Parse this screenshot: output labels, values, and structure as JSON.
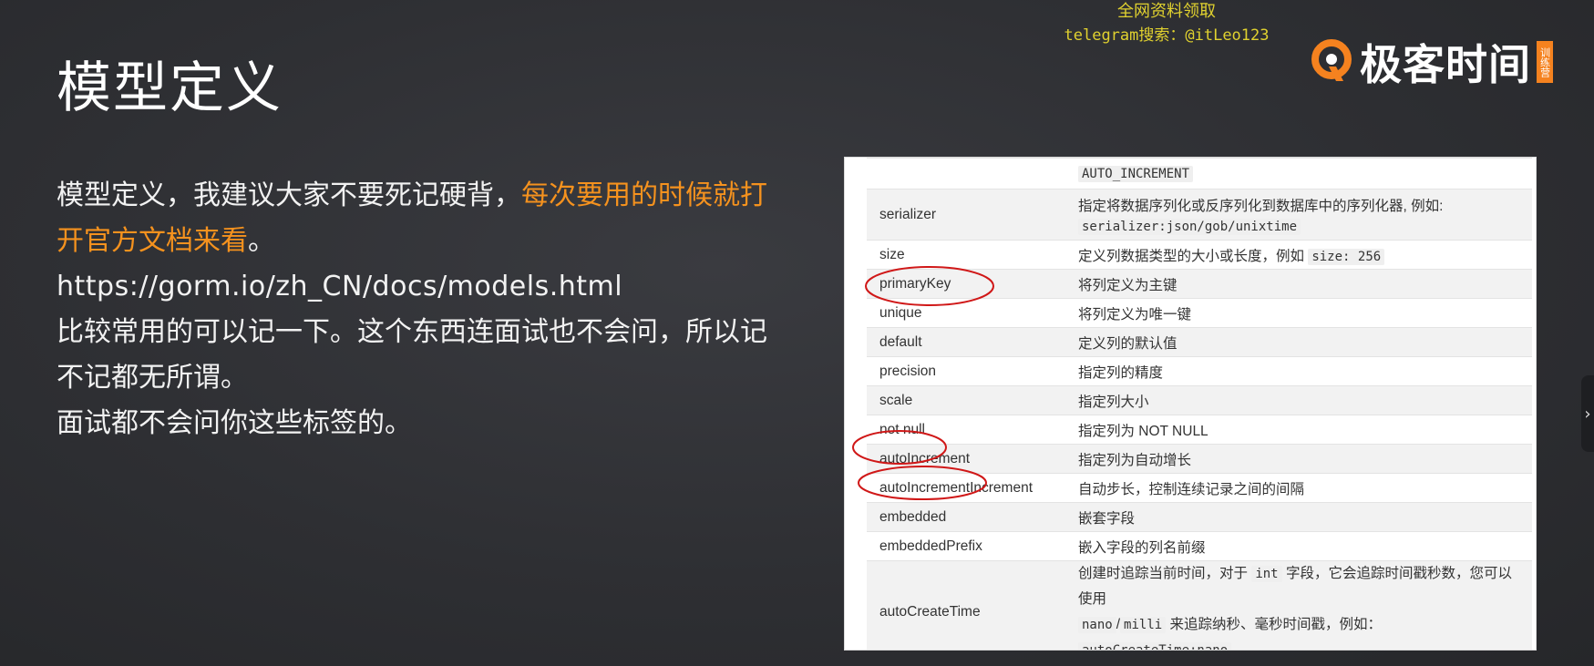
{
  "slide": {
    "title": "模型定义",
    "para1_plain": "模型定义，我建议大家不要死记硬背，",
    "para1_highlight": "每次要用的时候就打开官方文档来看",
    "para1_end": "。",
    "url": "https://gorm.io/zh_CN/docs/models.html",
    "para3": "比较常用的可以记一下。这个东西连面试也不会问，所以记不记都无所谓。",
    "para4": "面试都不会问你这些标签的。"
  },
  "watermark": {
    "line1": "全网资料领取",
    "line2": "telegram搜索：@itLeo123"
  },
  "logo": {
    "text": "极客时间",
    "badge": "训练营",
    "accent_color": "#f5821f"
  },
  "table": {
    "top_partial": "AUTO_INCREMENT",
    "rows": [
      {
        "tag": "serializer",
        "desc": "指定将数据序列化或反序列化到数据库中的序列化器, 例如:",
        "code": "serializer:json/gob/unixtime"
      },
      {
        "tag": "size",
        "desc": "定义列数据类型的大小或长度，例如",
        "code": "size: 256"
      },
      {
        "tag": "primaryKey",
        "desc": "将列定义为主键"
      },
      {
        "tag": "unique",
        "desc": "将列定义为唯一键"
      },
      {
        "tag": "default",
        "desc": "定义列的默认值"
      },
      {
        "tag": "precision",
        "desc": "指定列的精度"
      },
      {
        "tag": "scale",
        "desc": "指定列大小"
      },
      {
        "tag": "not null",
        "desc": "指定列为 NOT NULL"
      },
      {
        "tag": "autoIncrement",
        "desc": "指定列为自动增长"
      },
      {
        "tag": "autoIncrementIncrement",
        "desc": "自动步长，控制连续记录之间的间隔"
      },
      {
        "tag": "embedded",
        "desc": "嵌套字段"
      },
      {
        "tag": "embeddedPrefix",
        "desc": "嵌入字段的列名前缀"
      },
      {
        "tag": "autoCreateTime",
        "desc_a": "创建时追踪当前时间，对于",
        "code_a": "int",
        "desc_b": "字段，它会追踪时间戳秒数，您可以使用",
        "code_b": "nano",
        "sep": "/",
        "code_c": "milli",
        "desc_c": "来追踪纳秒、毫秒时间戳，例如：",
        "code_d": "autoCreateTime:nano"
      }
    ]
  },
  "nav": {
    "next_icon": "chevron-right-icon",
    "next_label": "›"
  }
}
